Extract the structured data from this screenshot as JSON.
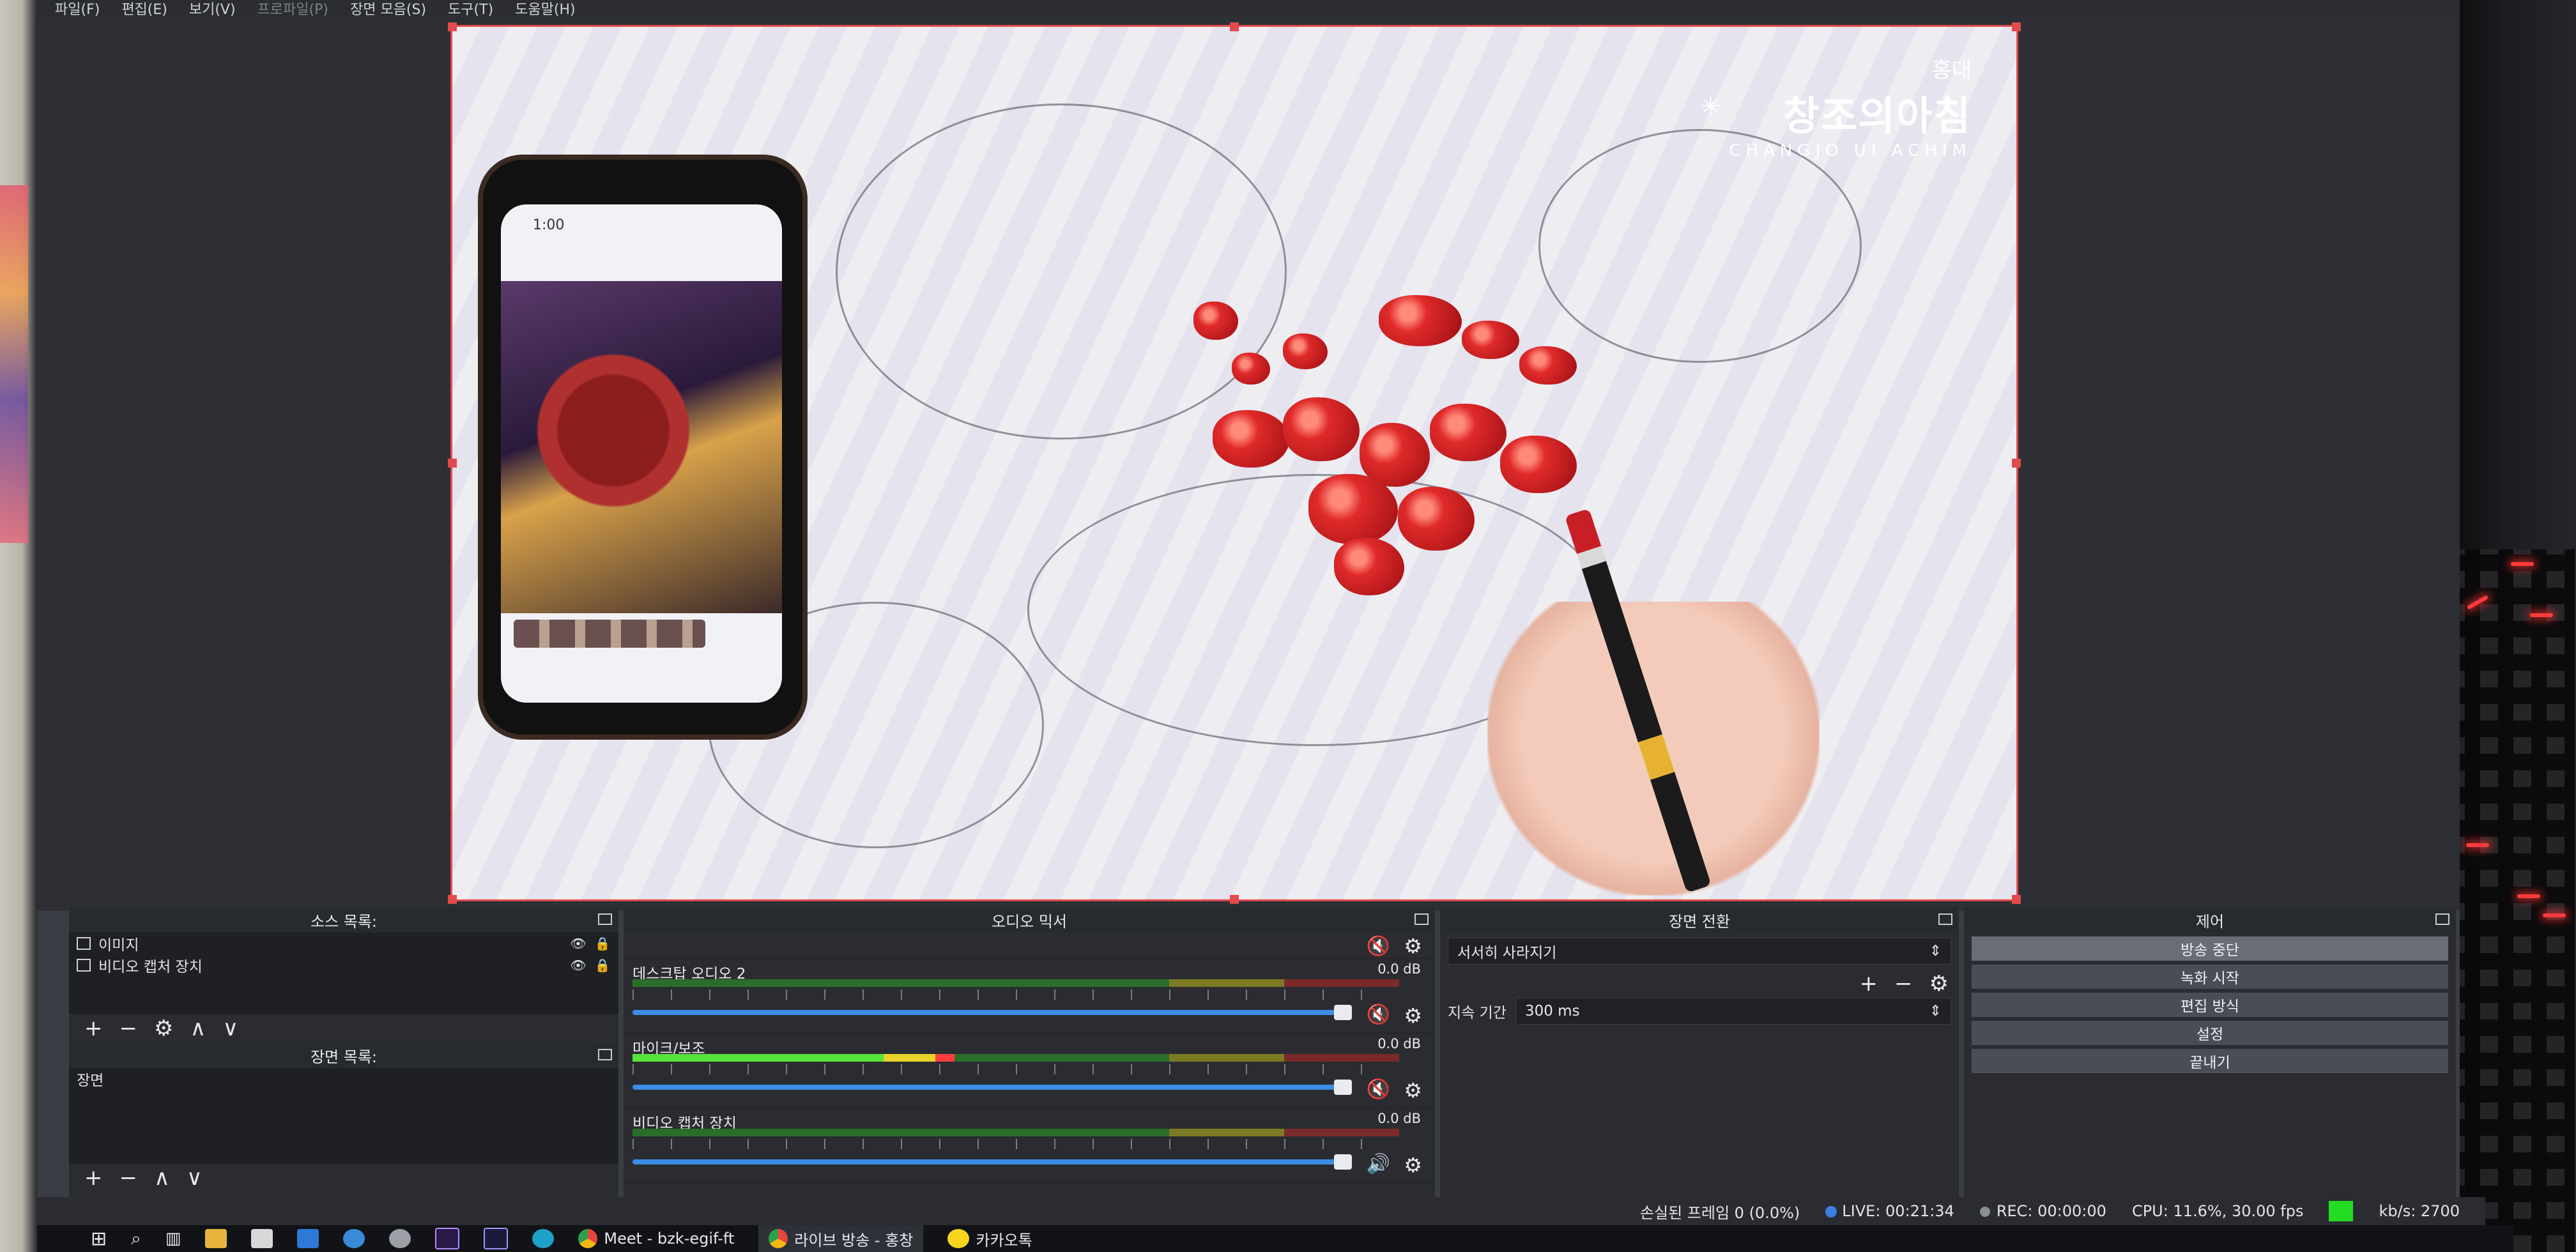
{
  "menubar": {
    "items": [
      "파일(F)",
      "편집(E)",
      "보기(V)",
      "프로파일(P)",
      "장면 모음(S)",
      "도구(T)",
      "도움말(H)"
    ]
  },
  "preview": {
    "watermark": {
      "small": "홍대",
      "title": "창조의아침",
      "subtitle": "CHANGJO UI ACHIM"
    },
    "phone_time": "1:00"
  },
  "sources": {
    "title": "소스 목록:",
    "items": [
      "이미지",
      "비디오 캡처 장치"
    ]
  },
  "scenes": {
    "title": "장면 목록:",
    "items": [
      "장면"
    ]
  },
  "mixer": {
    "title": "오디오 믹서",
    "channels": [
      {
        "name": "데스크탑 오디오 2",
        "db": "0.0 dB",
        "muted": true,
        "level": 0.0
      },
      {
        "name": "마이크/보조",
        "db": "0.0 dB",
        "muted": true,
        "level": 0.42
      },
      {
        "name": "비디오 캡처 장치",
        "db": "0.0 dB",
        "muted": false,
        "level": 0.0
      }
    ]
  },
  "transitions": {
    "title": "장면 전환",
    "selected": "서서히 사라지기",
    "duration_label": "지속 기간",
    "duration_value": "300 ms"
  },
  "controls": {
    "title": "제어",
    "buttons": [
      "방송 중단",
      "녹화 시작",
      "편집 방식",
      "설정",
      "끝내기"
    ]
  },
  "status": {
    "dropped": "손실된 프레임 0 (0.0%)",
    "live": "LIVE: 00:21:34",
    "rec": "REC: 00:00:00",
    "cpu": "CPU: 11.6%, 30.00 fps",
    "kbs": "kb/s: 2700",
    "indicator_color": "#22dd22"
  },
  "taskbar": {
    "apps": [
      {
        "label": "Meet - bzk-egif-ft",
        "active": false
      },
      {
        "label": "라이브 방송 - 홍창",
        "active": true
      },
      {
        "label": "카카오톡",
        "active": false
      }
    ]
  }
}
